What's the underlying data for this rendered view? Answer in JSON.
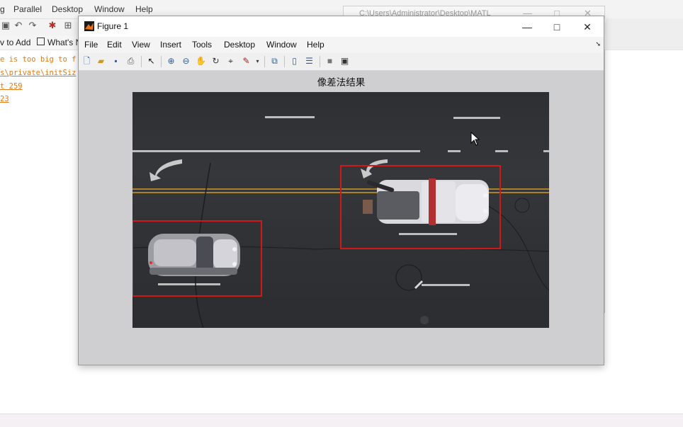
{
  "desktop": {
    "menu": [
      "g",
      "Parallel",
      "Desktop",
      "Window",
      "Help"
    ],
    "shortcuts": [
      "v to Add",
      "What's N"
    ],
    "command_lines": [
      "e is too big to f",
      "s\\private\\initSiz",
      "t 259",
      " 23"
    ],
    "window2_title": "C:\\Users\\Administrator\\Desktop\\MATL",
    "window2_controls": [
      "—",
      "□",
      "✕"
    ]
  },
  "figure": {
    "title": "Figure 1",
    "controls": {
      "minimize": "—",
      "maximize": "□",
      "close": "✕"
    },
    "menu": [
      "File",
      "Edit",
      "View",
      "Insert",
      "Tools",
      "Desktop",
      "Window",
      "Help"
    ],
    "menu_arrow": "➘",
    "toolbar_icons": [
      "new-figure-icon",
      "open-file-icon",
      "save-icon",
      "print-icon",
      "edit-plot-arrow-icon",
      "zoom-in-icon",
      "zoom-out-icon",
      "pan-hand-icon",
      "rotate-3d-icon",
      "data-cursor-icon",
      "brush-icon",
      "link-plot-icon",
      "colorbar-icon",
      "legend-icon",
      "hide-plot-tools-icon",
      "show-plot-tools-icon"
    ],
    "axes_title": "像差法结果"
  },
  "colors": {
    "detection_box": "#d01818",
    "figure_bg": "#cfcfd2",
    "command_text": "#e07a1a"
  }
}
